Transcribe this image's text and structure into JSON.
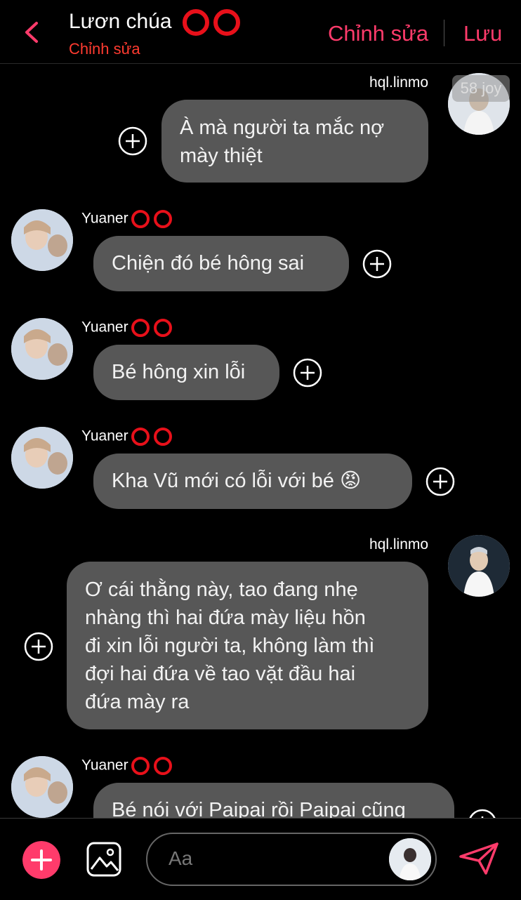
{
  "colors": {
    "accent": "#ff3b6b",
    "subtitle": "#ff3b30",
    "ring": "#e8101a",
    "bubble": "#575757"
  },
  "header": {
    "title": "Lươn chúa",
    "subtitle": "Chỉnh sửa",
    "edit_label": "Chỉnh sửa",
    "save_label": "Lưu"
  },
  "badge": "58 joy",
  "messages": [
    {
      "sender": "hql.linmo",
      "text_lines": [
        "À mà người ta mắc nợ",
        "mày thiệt"
      ]
    },
    {
      "sender": "Yuaner",
      "text_lines": [
        "Chiện đó bé hông sai"
      ]
    },
    {
      "sender": "Yuaner",
      "text_lines": [
        "Bé hông xin lỗi"
      ]
    },
    {
      "sender": "Yuaner",
      "text_lines": [
        "Kha Vũ mới có lỗi với bé 😡"
      ]
    },
    {
      "sender": "hql.linmo",
      "text_lines": [
        "Ơ cái thằng này, tao đang nhẹ",
        "nhàng thì hai đứa mày liệu hồn",
        "đi xin lỗi người ta, không làm thì",
        "đợi hai đứa về tao vặt đầu hai",
        "đứa mày ra"
      ]
    },
    {
      "sender": "Yuaner",
      "text_lines": [
        "Bé nói với Paipai rồi Paipai cũng"
      ]
    }
  ],
  "composer": {
    "placeholder": "Aa"
  },
  "icons": [
    "back-chevron-icon",
    "ring-icon",
    "plus-circle-icon",
    "add-icon",
    "image-icon",
    "send-icon"
  ]
}
